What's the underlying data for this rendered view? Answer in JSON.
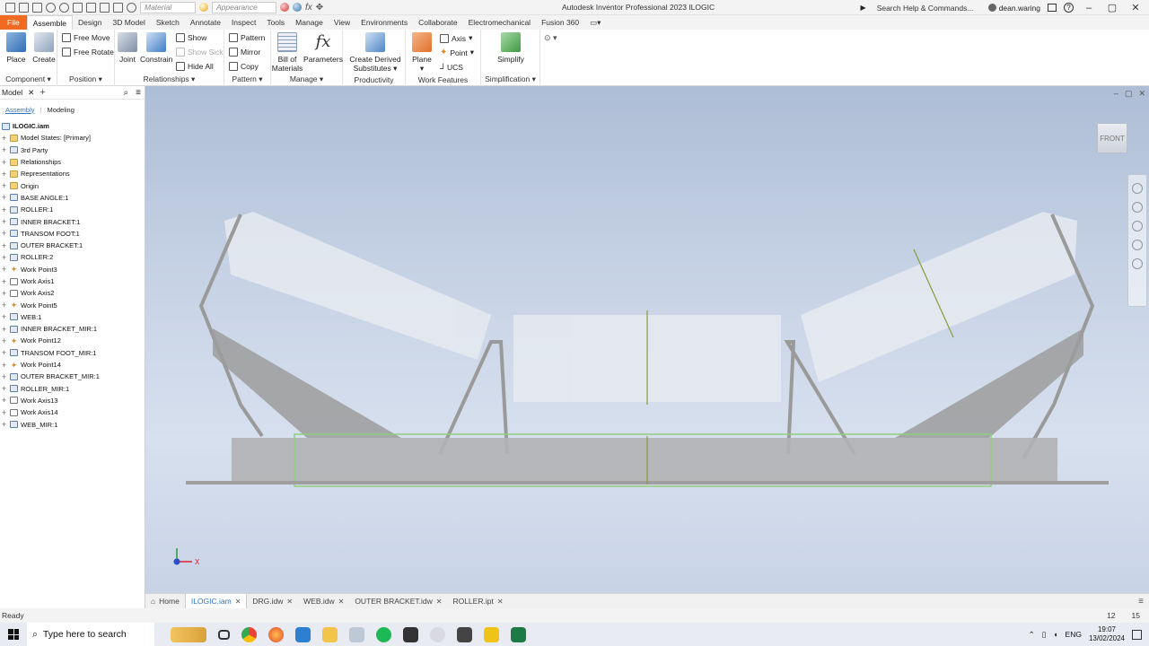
{
  "app": {
    "title": "Autodesk Inventor Professional 2023   ILOGIC",
    "material_placeholder": "Material",
    "appearance_placeholder": "Appearance",
    "search_placeholder": "Search Help & Commands...",
    "user": "dean.waring"
  },
  "ribbon_tabs": [
    "File",
    "Assemble",
    "Design",
    "3D Model",
    "Sketch",
    "Annotate",
    "Inspect",
    "Tools",
    "Manage",
    "View",
    "Environments",
    "Collaborate",
    "Electromechanical",
    "Fusion 360"
  ],
  "ribbon": {
    "component": {
      "label": "Component",
      "place": "Place",
      "create": "Create"
    },
    "position": {
      "label": "Position",
      "free_move": "Free Move",
      "free_rotate": "Free Rotate"
    },
    "relationships": {
      "label": "Relationships",
      "joint": "Joint",
      "constrain": "Constrain",
      "show": "Show",
      "show_sick": "Show Sick",
      "hide_all": "Hide All"
    },
    "pattern": {
      "label": "Pattern",
      "pattern": "Pattern",
      "mirror": "Mirror",
      "copy": "Copy"
    },
    "manage": {
      "label": "Manage",
      "bom_line1": "Bill of",
      "bom_line2": "Materials",
      "parameters": "Parameters"
    },
    "productivity": {
      "label": "Productivity",
      "derived_line1": "Create Derived",
      "derived_line2": "Substitutes"
    },
    "work_features": {
      "label": "Work Features",
      "plane": "Plane",
      "axis": "Axis",
      "point": "Point",
      "ucs": "UCS"
    },
    "simplification": {
      "label": "Simplification",
      "simplify": "Simplify"
    }
  },
  "browser": {
    "title": "Model",
    "add": "+",
    "subtabs": {
      "assembly": "Assembly",
      "modeling": "Modeling"
    },
    "root": "ILOGIC.iam",
    "items": [
      {
        "label": "Model States: [Primary]",
        "type": "folder"
      },
      {
        "label": "3rd Party",
        "type": "part"
      },
      {
        "label": "Relationships",
        "type": "folder"
      },
      {
        "label": "Representations",
        "type": "folder"
      },
      {
        "label": "Origin",
        "type": "folder"
      },
      {
        "label": "BASE ANGLE:1",
        "type": "part"
      },
      {
        "label": "ROLLER:1",
        "type": "part"
      },
      {
        "label": "INNER BRACKET:1",
        "type": "part"
      },
      {
        "label": "TRANSOM FOOT:1",
        "type": "part"
      },
      {
        "label": "OUTER BRACKET:1",
        "type": "part"
      },
      {
        "label": "ROLLER:2",
        "type": "part"
      },
      {
        "label": "Work Point3",
        "type": "point"
      },
      {
        "label": "Work Axis1",
        "type": "axis"
      },
      {
        "label": "Work Axis2",
        "type": "axis"
      },
      {
        "label": "Work Point5",
        "type": "point"
      },
      {
        "label": "WEB:1",
        "type": "part"
      },
      {
        "label": "INNER BRACKET_MIR:1",
        "type": "part"
      },
      {
        "label": "Work Point12",
        "type": "point"
      },
      {
        "label": "TRANSOM FOOT_MIR:1",
        "type": "part"
      },
      {
        "label": "Work Point14",
        "type": "point"
      },
      {
        "label": "OUTER BRACKET_MIR:1",
        "type": "part"
      },
      {
        "label": "ROLLER_MIR:1",
        "type": "part"
      },
      {
        "label": "Work Axis13",
        "type": "axis"
      },
      {
        "label": "Work Axis14",
        "type": "axis"
      },
      {
        "label": "WEB_MIR:1",
        "type": "part"
      }
    ]
  },
  "viewport": {
    "viewcube_label": "FRONT",
    "triad_x": "X"
  },
  "doc_tabs": [
    {
      "label": "Home",
      "active": false
    },
    {
      "label": "ILOGIC.iam",
      "active": true
    },
    {
      "label": "DRG.idw",
      "active": false
    },
    {
      "label": "WEB.idw",
      "active": false
    },
    {
      "label": "OUTER BRACKET.idw",
      "active": false
    },
    {
      "label": "ROLLER.ipt",
      "active": false
    }
  ],
  "status": {
    "text": "Ready",
    "num1": "12",
    "num2": "15"
  },
  "taskbar": {
    "search_placeholder": "Type here to search",
    "lang": "ENG",
    "time": "19:07",
    "date": "13/02/2024"
  }
}
